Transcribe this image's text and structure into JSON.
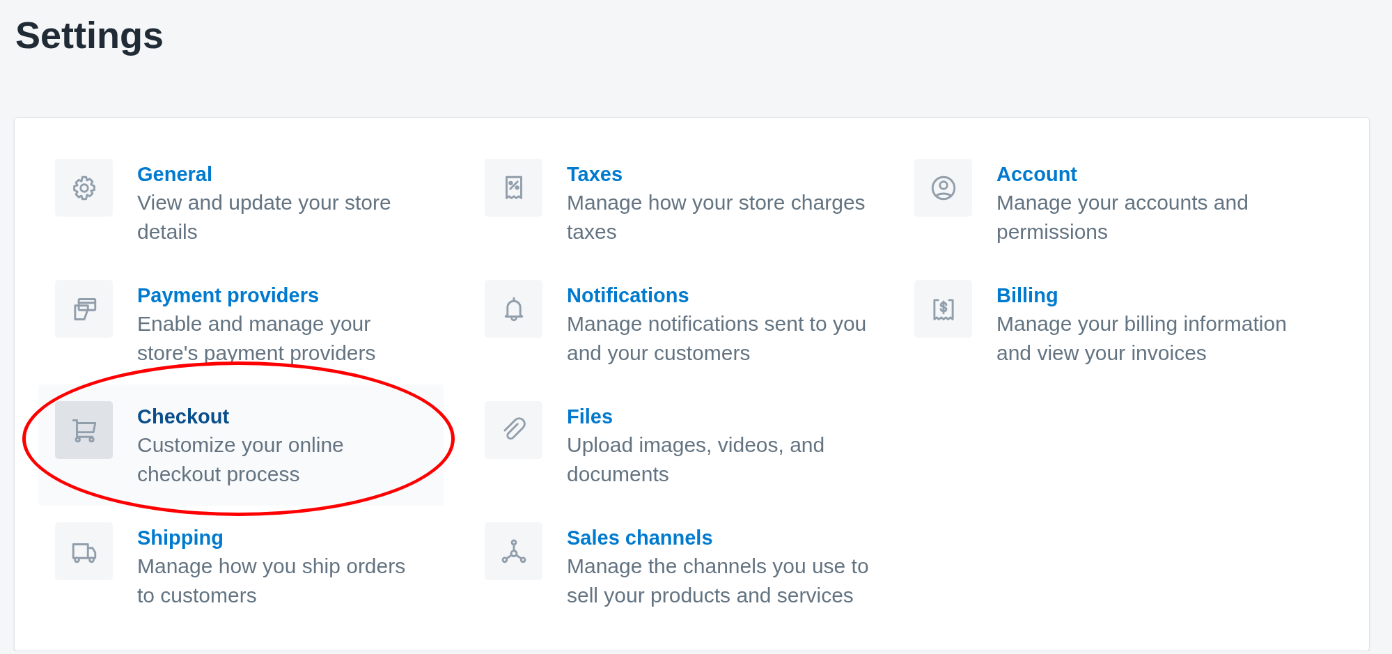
{
  "page": {
    "title": "Settings"
  },
  "columns": [
    {
      "items": [
        {
          "kind": "gear",
          "title": "General",
          "description": "View and update your store details",
          "selected": false,
          "circled": false
        },
        {
          "kind": "cards",
          "title": "Payment providers",
          "description": "Enable and manage your store's payment providers",
          "selected": false,
          "circled": false
        },
        {
          "kind": "cart",
          "title": "Checkout",
          "description": "Customize your online checkout process",
          "selected": true,
          "circled": true
        },
        {
          "kind": "truck",
          "title": "Shipping",
          "description": "Manage how you ship orders to customers",
          "selected": false,
          "circled": false
        }
      ]
    },
    {
      "items": [
        {
          "kind": "tax",
          "title": "Taxes",
          "description": "Manage how your store charges taxes",
          "selected": false,
          "circled": false
        },
        {
          "kind": "bell",
          "title": "Notifications",
          "description": "Manage notifications sent to you and your customers",
          "selected": false,
          "circled": false
        },
        {
          "kind": "clip",
          "title": "Files",
          "description": "Upload images, videos, and documents",
          "selected": false,
          "circled": false
        },
        {
          "kind": "nodes",
          "title": "Sales channels",
          "description": "Manage the channels you use to sell your products and services",
          "selected": false,
          "circled": false
        }
      ]
    },
    {
      "items": [
        {
          "kind": "user",
          "title": "Account",
          "description": "Manage your accounts and permissions",
          "selected": false,
          "circled": false
        },
        {
          "kind": "bill",
          "title": "Billing",
          "description": "Manage your billing information and view your invoices",
          "selected": false,
          "circled": false
        }
      ]
    }
  ]
}
